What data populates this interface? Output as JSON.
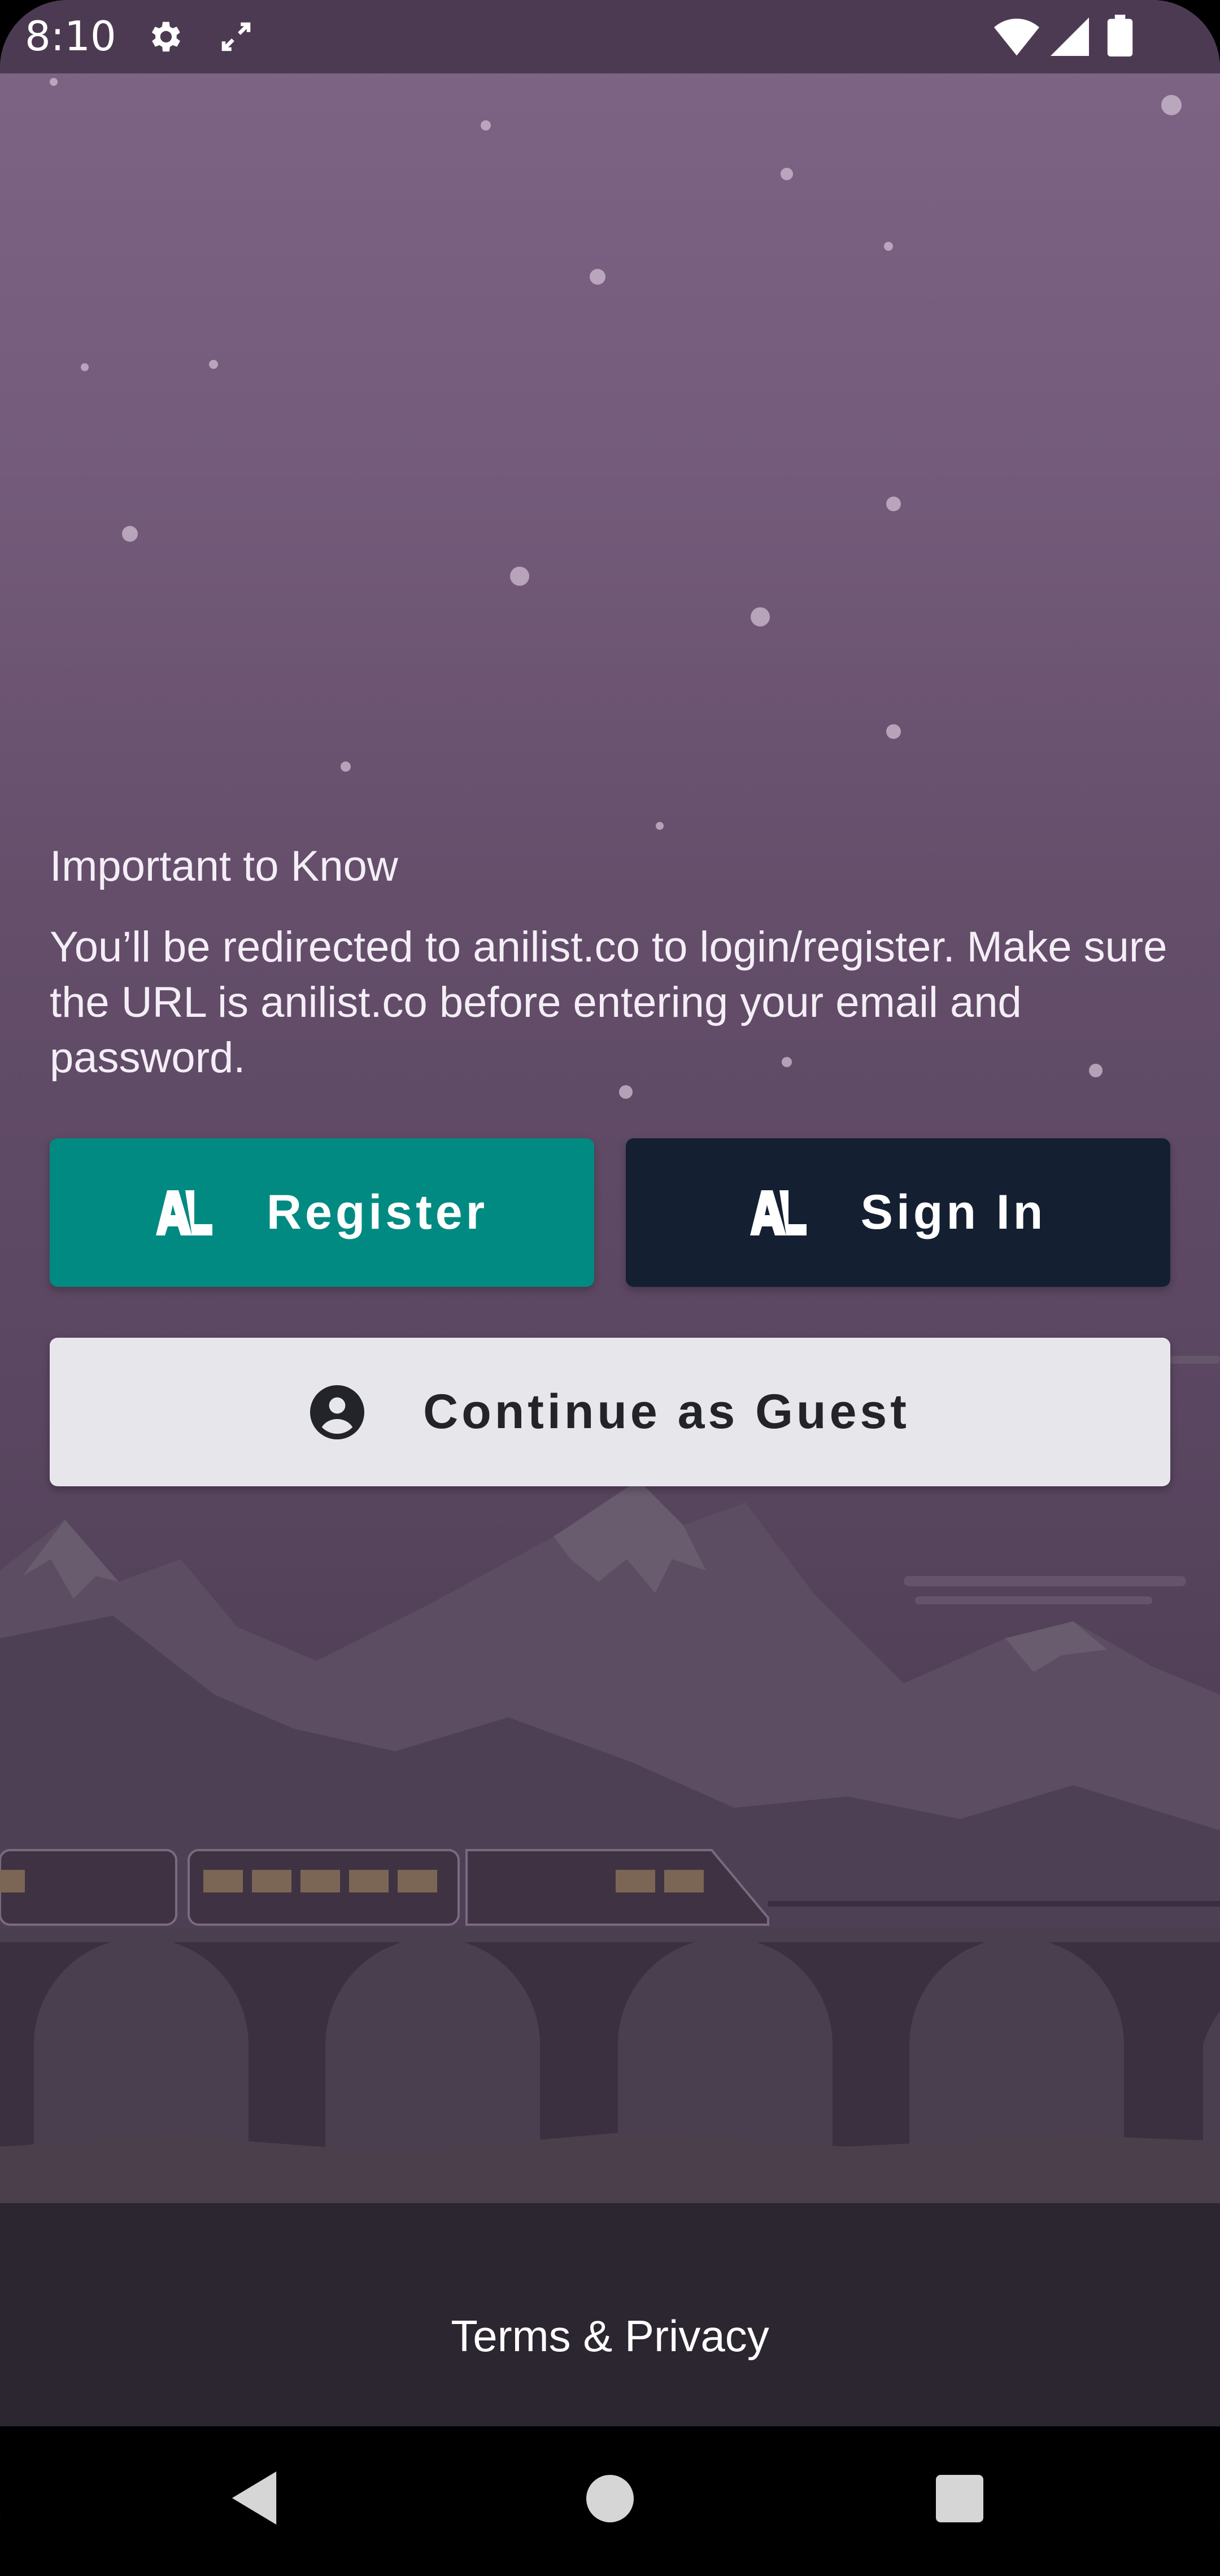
{
  "status_bar": {
    "time": "8:10",
    "icons": [
      "gear-icon",
      "expand-icon",
      "wifi-icon",
      "signal-icon",
      "battery-icon"
    ]
  },
  "notice": {
    "title": "Important to Know",
    "body": "You’ll be redirected to anilist.co to login/register. Make sure the URL is anilist.co before entering your email and password."
  },
  "buttons": {
    "register": "Register",
    "sign_in": "Sign In",
    "guest": "Continue as Guest"
  },
  "footer": {
    "terms": "Terms & Privacy"
  },
  "nav_bar": {
    "icons": [
      "back-icon",
      "home-icon",
      "recents-icon"
    ]
  },
  "colors": {
    "register_bg": "#008a81",
    "sign_in_bg": "#142032",
    "guest_bg": "#e7e7eb",
    "status_bar_bg": "#4c3a52"
  }
}
